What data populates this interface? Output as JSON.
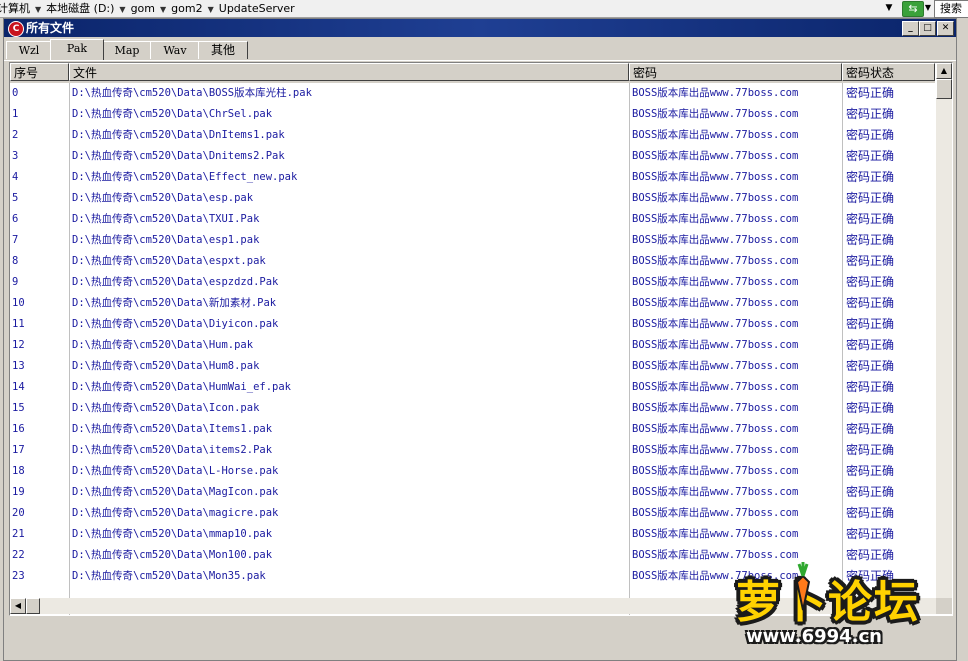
{
  "address_bar": {
    "crumbs": [
      "计算机",
      "本地磁盘 (D:)",
      "gom",
      "gom2",
      "UpdateServer"
    ],
    "dropdown_icon": "chevron-down-icon",
    "refresh_icon": "refresh-icon",
    "search_label": "搜索"
  },
  "window": {
    "title": "所有文件",
    "icon": "app-logo-icon",
    "buttons": [
      "minimize-icon",
      "maximize-icon",
      "close-icon"
    ]
  },
  "tabs": [
    {
      "label": "Wzl",
      "active": false
    },
    {
      "label": "Pak",
      "active": true
    },
    {
      "label": "Map",
      "active": false
    },
    {
      "label": "Wav",
      "active": false
    },
    {
      "label": "其他",
      "active": false
    }
  ],
  "table": {
    "columns": [
      "序号",
      "文件",
      "密码",
      "密码状态"
    ],
    "rows": [
      {
        "no": "0",
        "file": "D:\\热血传奇\\cm520\\Data\\BOSS版本库光柱.pak",
        "password": "BOSS版本库出品www.77boss.com",
        "status": "密码正确"
      },
      {
        "no": "1",
        "file": "D:\\热血传奇\\cm520\\Data\\ChrSel.pak",
        "password": "BOSS版本库出品www.77boss.com",
        "status": "密码正确"
      },
      {
        "no": "2",
        "file": "D:\\热血传奇\\cm520\\Data\\DnItems1.pak",
        "password": "BOSS版本库出品www.77boss.com",
        "status": "密码正确"
      },
      {
        "no": "3",
        "file": "D:\\热血传奇\\cm520\\Data\\Dnitems2.Pak",
        "password": "BOSS版本库出品www.77boss.com",
        "status": "密码正确"
      },
      {
        "no": "4",
        "file": "D:\\热血传奇\\cm520\\Data\\Effect_new.pak",
        "password": "BOSS版本库出品www.77boss.com",
        "status": "密码正确"
      },
      {
        "no": "5",
        "file": "D:\\热血传奇\\cm520\\Data\\esp.pak",
        "password": "BOSS版本库出品www.77boss.com",
        "status": "密码正确"
      },
      {
        "no": "6",
        "file": "D:\\热血传奇\\cm520\\Data\\TXUI.Pak",
        "password": "BOSS版本库出品www.77boss.com",
        "status": "密码正确"
      },
      {
        "no": "7",
        "file": "D:\\热血传奇\\cm520\\Data\\esp1.pak",
        "password": "BOSS版本库出品www.77boss.com",
        "status": "密码正确"
      },
      {
        "no": "8",
        "file": "D:\\热血传奇\\cm520\\Data\\espxt.pak",
        "password": "BOSS版本库出品www.77boss.com",
        "status": "密码正确"
      },
      {
        "no": "9",
        "file": "D:\\热血传奇\\cm520\\Data\\espzdzd.Pak",
        "password": "BOSS版本库出品www.77boss.com",
        "status": "密码正确"
      },
      {
        "no": "10",
        "file": "D:\\热血传奇\\cm520\\Data\\新加素材.Pak",
        "password": "BOSS版本库出品www.77boss.com",
        "status": "密码正确"
      },
      {
        "no": "11",
        "file": "D:\\热血传奇\\cm520\\Data\\Diyicon.pak",
        "password": "BOSS版本库出品www.77boss.com",
        "status": "密码正确"
      },
      {
        "no": "12",
        "file": "D:\\热血传奇\\cm520\\Data\\Hum.pak",
        "password": "BOSS版本库出品www.77boss.com",
        "status": "密码正确"
      },
      {
        "no": "13",
        "file": "D:\\热血传奇\\cm520\\Data\\Hum8.pak",
        "password": "BOSS版本库出品www.77boss.com",
        "status": "密码正确"
      },
      {
        "no": "14",
        "file": "D:\\热血传奇\\cm520\\Data\\HumWai_ef.pak",
        "password": "BOSS版本库出品www.77boss.com",
        "status": "密码正确"
      },
      {
        "no": "15",
        "file": "D:\\热血传奇\\cm520\\Data\\Icon.pak",
        "password": "BOSS版本库出品www.77boss.com",
        "status": "密码正确"
      },
      {
        "no": "16",
        "file": "D:\\热血传奇\\cm520\\Data\\Items1.pak",
        "password": "BOSS版本库出品www.77boss.com",
        "status": "密码正确"
      },
      {
        "no": "17",
        "file": "D:\\热血传奇\\cm520\\Data\\items2.Pak",
        "password": "BOSS版本库出品www.77boss.com",
        "status": "密码正确"
      },
      {
        "no": "18",
        "file": "D:\\热血传奇\\cm520\\Data\\L-Horse.pak",
        "password": "BOSS版本库出品www.77boss.com",
        "status": "密码正确"
      },
      {
        "no": "19",
        "file": "D:\\热血传奇\\cm520\\Data\\MagIcon.pak",
        "password": "BOSS版本库出品www.77boss.com",
        "status": "密码正确"
      },
      {
        "no": "20",
        "file": "D:\\热血传奇\\cm520\\Data\\magicre.pak",
        "password": "BOSS版本库出品www.77boss.com",
        "status": "密码正确"
      },
      {
        "no": "21",
        "file": "D:\\热血传奇\\cm520\\Data\\mmap10.pak",
        "password": "BOSS版本库出品www.77boss.com",
        "status": "密码正确"
      },
      {
        "no": "22",
        "file": "D:\\热血传奇\\cm520\\Data\\Mon100.pak",
        "password": "BOSS版本库出品www.77boss.com",
        "status": "密码正确"
      },
      {
        "no": "23",
        "file": "D:\\热血传奇\\cm520\\Data\\Mon35.pak",
        "password": "BOSS版本库出品www.77boss.com",
        "status": "密码正确"
      }
    ]
  },
  "watermark": {
    "logo_text": "萝卜论坛",
    "url": "www.6994.cn"
  },
  "colors": {
    "title_bar": "#0a246a",
    "row_text": "#1a1aa0",
    "window_face": "#d4d0c8"
  }
}
